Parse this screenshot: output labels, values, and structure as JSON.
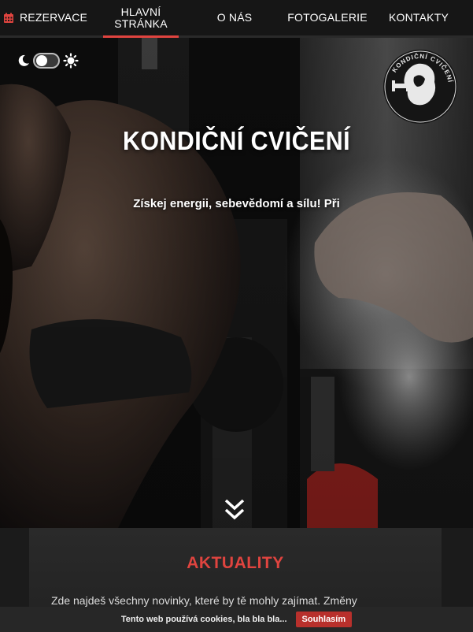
{
  "nav": {
    "reservation_label": "REZERVACE",
    "home_label_line1": "HLAVNÍ",
    "home_label_line2": "STRÁNKA",
    "about_label": "O NÁS",
    "gallery_label": "FOTOGALERIE",
    "contacts_label": "KONTAKTY"
  },
  "hero": {
    "title": "KONDIČNÍ CVIČENÍ",
    "subtitle": "Získej energii, sebevědomí a sílu! Při",
    "logo_text": "KONDIČNÍ CVIČENÍ"
  },
  "news": {
    "title": "AKTUALITY",
    "text": "Zde najdeš všechny novinky, které by tě mohly zajímat. Změny"
  },
  "cookie": {
    "text": "Tento web používá cookies, bla bla bla...",
    "accept_label": "Souhlasím"
  },
  "icons": {
    "calendar": "calendar-icon",
    "moon": "moon-icon",
    "sun": "sun-icon",
    "scroll_down": "double-chevron-down-icon"
  },
  "colors": {
    "accent": "#e0443f",
    "cookie_button": "#b8302c",
    "nav_bg": "#161616"
  }
}
